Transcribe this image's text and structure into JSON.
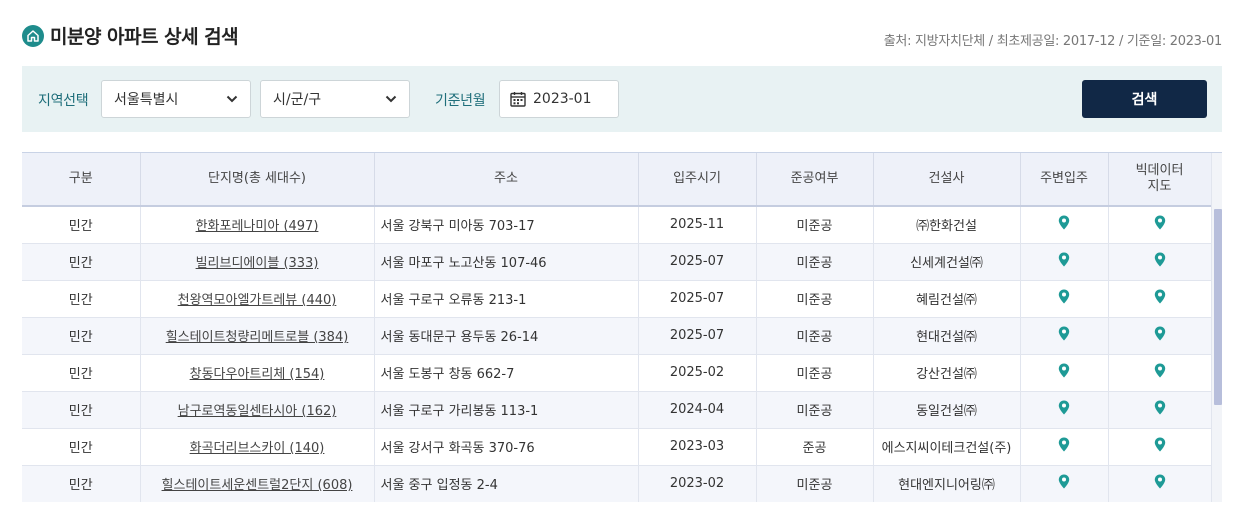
{
  "header": {
    "title": "미분양 아파트 상세 검색",
    "source": "출처: 지방자치단체 / 최초제공일: 2017-12 / 기준일: 2023-01"
  },
  "filter": {
    "region_label": "지역선택",
    "city_value": "서울특별시",
    "district_value": "시/군/구",
    "date_label": "기준년월",
    "date_value": "2023-01",
    "search_label": "검색"
  },
  "table": {
    "columns": [
      "구분",
      "단지명(총 세대수)",
      "주소",
      "입주시기",
      "준공여부",
      "건설사",
      "주변입주",
      "빅데이터 지도"
    ],
    "rows": [
      {
        "type": "민간",
        "name": "한화포레나미아 (497)",
        "address": "서울 강북구 미아동 703-17",
        "move_in": "2025-11",
        "status": "미준공",
        "builder": "㈜한화건설"
      },
      {
        "type": "민간",
        "name": "빌리브디에이블 (333)",
        "address": "서울 마포구 노고산동 107-46",
        "move_in": "2025-07",
        "status": "미준공",
        "builder": "신세계건설㈜"
      },
      {
        "type": "민간",
        "name": "천왕역모아엘가트레뷰 (440)",
        "address": "서울 구로구 오류동 213-1",
        "move_in": "2025-07",
        "status": "미준공",
        "builder": "혜림건설㈜"
      },
      {
        "type": "민간",
        "name": "힐스테이트청량리메트로블 (384)",
        "address": "서울 동대문구 용두동 26-14",
        "move_in": "2025-07",
        "status": "미준공",
        "builder": "현대건설㈜"
      },
      {
        "type": "민간",
        "name": "창동다우아트리체 (154)",
        "address": "서울 도봉구 창동 662-7",
        "move_in": "2025-02",
        "status": "미준공",
        "builder": "강산건설㈜"
      },
      {
        "type": "민간",
        "name": "남구로역동일센타시아 (162)",
        "address": "서울 구로구 가리봉동 113-1",
        "move_in": "2024-04",
        "status": "미준공",
        "builder": "동일건설㈜"
      },
      {
        "type": "민간",
        "name": "화곡더리브스카이 (140)",
        "address": "서울 강서구 화곡동 370-76",
        "move_in": "2023-03",
        "status": "준공",
        "builder": "에스지씨이테크건설(주)"
      },
      {
        "type": "민간",
        "name": "힐스테이트세운센트럴2단지 (608)",
        "address": "서울 중구 입정동 2-4",
        "move_in": "2023-02",
        "status": "미준공",
        "builder": "현대엔지니어링㈜"
      }
    ]
  },
  "colors": {
    "accent": "#1e8c8c",
    "button": "#112846",
    "filter_bg": "#e8f2f3",
    "header_bg": "#eef1f9"
  },
  "icons": {
    "title": "home-icon",
    "dropdown": "chevron-down-icon",
    "date": "calendar-icon",
    "location": "map-pin-icon"
  }
}
